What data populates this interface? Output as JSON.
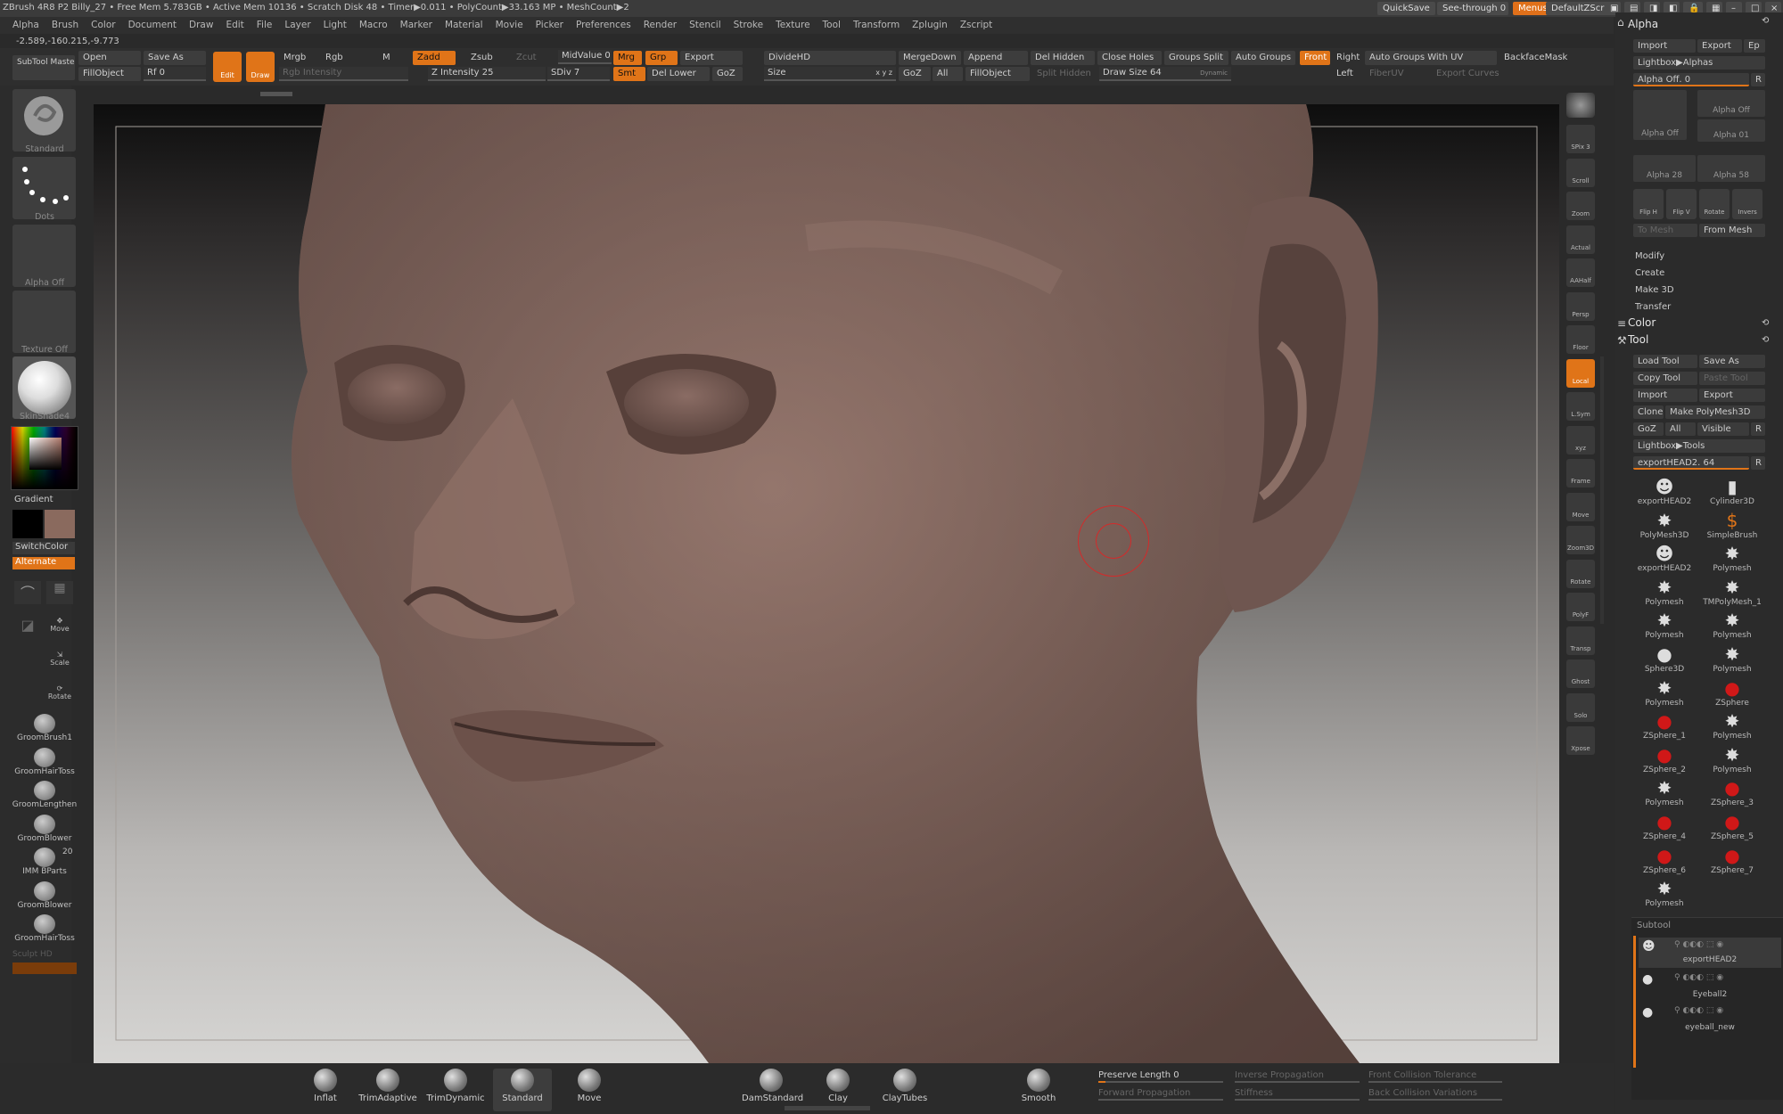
{
  "titlebar": {
    "text": "ZBrush 4R8 P2    Billy_27    • Free Mem 5.783GB • Active Mem 10136 • Scratch Disk 48 • Timer▶0.011 • PolyCount▶33.163 MP • MeshCount▶2",
    "quicksave": "QuickSave",
    "see_through": "See-through  0",
    "menus": "Menus",
    "script": "DefaultZScript"
  },
  "menubar": [
    "Alpha",
    "Brush",
    "Color",
    "Document",
    "Draw",
    "Edit",
    "File",
    "Layer",
    "Light",
    "Macro",
    "Marker",
    "Material",
    "Movie",
    "Picker",
    "Preferences",
    "Render",
    "Stencil",
    "Stroke",
    "Texture",
    "Tool",
    "Transform",
    "Zplugin",
    "Zscript"
  ],
  "coords": "-2.589,-160.215,-9.773",
  "shelf": {
    "subtool_master": "SubTool Master",
    "open": "Open",
    "save_as": "Save As",
    "fill_object": "FillObject",
    "rf": "Rf 0",
    "edit": "Edit",
    "draw": "Draw",
    "mrgb": "Mrgb",
    "rgb": "Rgb",
    "m": "M",
    "rgb_intensity": "Rgb Intensity",
    "zadd": "Zadd",
    "zsub": "Zsub",
    "zcut": "Zcut",
    "z_intensity": "Z Intensity 25",
    "midvalue": "MidValue 0",
    "mrg": "Mrg",
    "grp": "Grp",
    "export": "Export",
    "sdiv": "SDiv 7",
    "smt": "Smt",
    "del_lower": "Del Lower",
    "goz": "GoZ",
    "dividehd": "DivideHD",
    "size": "Size",
    "xyz": "x y z",
    "mergedown": "MergeDown",
    "append": "Append",
    "del_hidden": "Del Hidden",
    "close_holes": "Close Holes",
    "groups_split": "Groups Split",
    "auto_groups": "Auto Groups",
    "front": "Front",
    "right": "Right",
    "auto_groups_uv": "Auto Groups With UV",
    "backface_mask": "BackfaceMask",
    "goz2": "GoZ",
    "all": "All",
    "fillobject2": "FillObject",
    "split_hidden": "Split Hidden",
    "draw_size": "Draw Size 64",
    "dynamic": "Dynamic",
    "left": "Left",
    "fiberuv": "FiberUV",
    "export_curves": "Export Curves"
  },
  "left_panel": {
    "brush_label": "Standard",
    "stroke_label": "Dots",
    "alpha_label": "Alpha Off",
    "texture_label": "Texture Off",
    "material_label": "SkinShade4",
    "gradient": "Gradient",
    "switch_color": "SwitchColor",
    "alternate": "Alternate",
    "tools": [
      {
        "label": "GroomBrush1"
      },
      {
        "label": "GroomHairToss"
      },
      {
        "label": "GroomLengthen"
      },
      {
        "label": "GroomBlower"
      },
      {
        "label": "IMM BParts",
        "count": "20"
      },
      {
        "label": "GroomBlower"
      },
      {
        "label": "GroomHairToss"
      }
    ],
    "sculpt_hd": "Sculpt HD"
  },
  "right_toolbar": [
    {
      "label": "SPix 3"
    },
    {
      "label": "Scroll"
    },
    {
      "label": "Zoom"
    },
    {
      "label": "Actual"
    },
    {
      "label": "AAHalf"
    },
    {
      "label": "Persp"
    },
    {
      "label": "Floor"
    },
    {
      "label": "Local"
    },
    {
      "label": "L.Sym"
    },
    {
      "label": "xyz"
    },
    {
      "label": "Frame"
    },
    {
      "label": "Move"
    },
    {
      "label": "Zoom3D"
    },
    {
      "label": "Rotate"
    },
    {
      "label": "PolyF"
    },
    {
      "label": "Transp"
    },
    {
      "label": "Ghost"
    },
    {
      "label": "Solo"
    },
    {
      "label": "Xpose"
    }
  ],
  "right_panel": {
    "alpha_title": "Alpha",
    "import": "Import",
    "export": "Export",
    "ep": "Ep",
    "lightbox_alphas": "Lightbox▶Alphas",
    "alpha_off_slider": "Alpha Off. 0",
    "alpha_items": [
      {
        "label": "Alpha Off"
      },
      {
        "label": "Alpha Off"
      },
      {
        "label": "Alpha 01"
      },
      {
        "label": "Alpha 28"
      },
      {
        "label": "Alpha 58"
      }
    ],
    "alpha_tools": [
      "Flip H",
      "Flip V",
      "Rotate",
      "Invers"
    ],
    "to_mesh": "To Mesh",
    "from_mesh": "From Mesh",
    "modify": "Modify",
    "create": "Create",
    "make3d": "Make 3D",
    "transfer": "Transfer",
    "color_title": "Color",
    "tool_title": "Tool",
    "load_tool": "Load Tool",
    "save_as": "Save As",
    "copy_tool": "Copy Tool",
    "paste_tool": "Paste Tool",
    "t_import": "Import",
    "t_export": "Export",
    "clone": "Clone",
    "make_polymesh": "Make PolyMesh3D",
    "goz": "GoZ",
    "all": "All",
    "visible": "Visible",
    "r": "R",
    "lightbox_tools": "Lightbox▶Tools",
    "current_tool": "exportHEAD2. 64",
    "tool_items": [
      {
        "label": "exportHEAD2",
        "icon": "head"
      },
      {
        "label": "Cylinder3D",
        "icon": "cyl"
      },
      {
        "label": "PolyMesh3D",
        "icon": "star"
      },
      {
        "label": "SimpleBrush",
        "icon": "s"
      },
      {
        "label": "exportHEAD2",
        "icon": "head"
      },
      {
        "label": "Polymesh",
        "icon": "star"
      },
      {
        "label": "Polymesh",
        "icon": "star"
      },
      {
        "label": "TMPolyMesh_1",
        "icon": "star"
      },
      {
        "label": "Polymesh",
        "icon": "star"
      },
      {
        "label": "Polymesh",
        "icon": "star"
      },
      {
        "label": "Sphere3D",
        "icon": "sphere"
      },
      {
        "label": "Polymesh",
        "icon": "star"
      },
      {
        "label": "Polymesh",
        "icon": "star"
      },
      {
        "label": "ZSphere",
        "icon": "red"
      },
      {
        "label": "ZSphere_1",
        "icon": "red"
      },
      {
        "label": "Polymesh",
        "icon": "star"
      },
      {
        "label": "ZSphere_2",
        "icon": "red"
      },
      {
        "label": "Polymesh",
        "icon": "star"
      },
      {
        "label": "Polymesh",
        "icon": "star"
      },
      {
        "label": "ZSphere_3",
        "icon": "red"
      },
      {
        "label": "ZSphere_4",
        "icon": "red"
      },
      {
        "label": "ZSphere_5",
        "icon": "red"
      },
      {
        "label": "ZSphere_6",
        "icon": "red"
      },
      {
        "label": "ZSphere_7",
        "icon": "red"
      },
      {
        "label": "Polymesh",
        "icon": "star"
      }
    ],
    "subtool_title": "Subtool",
    "subtools": [
      {
        "label": "exportHEAD2"
      },
      {
        "label": "Eyeball2"
      },
      {
        "label": "eyeball_new"
      }
    ]
  },
  "bottom_brushes": [
    {
      "label": "Inflat"
    },
    {
      "label": "TrimAdaptive"
    },
    {
      "label": "TrimDynamic"
    },
    {
      "label": "Standard"
    },
    {
      "label": "Move"
    },
    {
      "label": "DamStandard"
    },
    {
      "label": "Clay"
    },
    {
      "label": "ClayTubes"
    },
    {
      "label": "Smooth"
    }
  ],
  "bottom_sliders": {
    "preserve_length": "Preserve Length 0",
    "inverse_propagation": "Inverse Propagation",
    "front_collision": "Front Collision Tolerance",
    "forward_propagation": "Forward Propagation",
    "stiffness": "Stiffness",
    "back_collision": "Back Collision Variations"
  },
  "colors": {
    "accent": "#e07418",
    "panel": "#2b2b2b",
    "skin": "#8a6a5e"
  }
}
